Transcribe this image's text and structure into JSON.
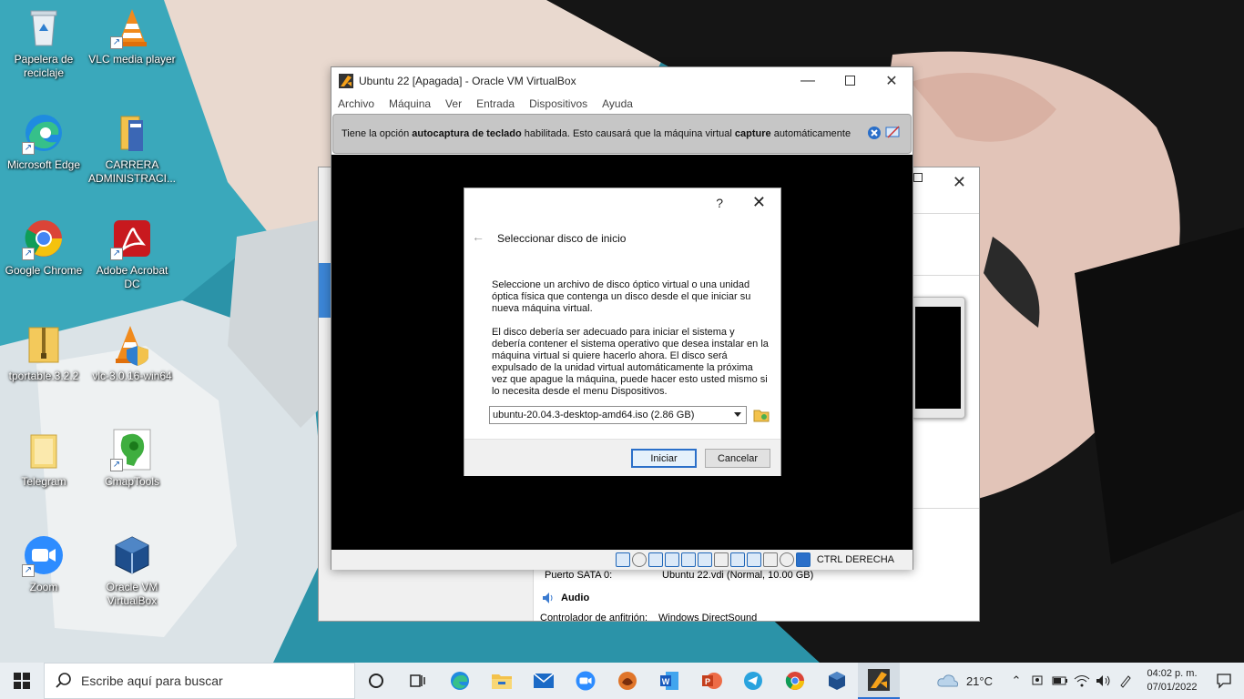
{
  "desktop": {
    "icons": [
      {
        "label": "Papelera de reciclaje",
        "icon": "recycle-bin-icon"
      },
      {
        "label": "VLC media player",
        "icon": "vlc-icon"
      },
      {
        "label": "Microsoft Edge",
        "icon": "edge-icon"
      },
      {
        "label": "CARRERA ADMINISTRACI...",
        "icon": "folder-archive-icon"
      },
      {
        "label": "Google Chrome",
        "icon": "chrome-icon"
      },
      {
        "label": "Adobe Acrobat DC",
        "icon": "acrobat-icon"
      },
      {
        "label": "tportable.3.2.2",
        "icon": "zip-folder-icon"
      },
      {
        "label": "vlc-3.0.16-win64",
        "icon": "vlc-installer-icon"
      },
      {
        "label": "Telegram",
        "icon": "folder-icon"
      },
      {
        "label": "CmapTools",
        "icon": "cmaptools-icon"
      },
      {
        "label": "Zoom",
        "icon": "zoom-icon"
      },
      {
        "label": "Oracle VM VirtualBox",
        "icon": "virtualbox-icon"
      }
    ]
  },
  "back_window": {
    "storage_label": "Puerto SATA 0:",
    "storage_value": "Ubuntu 22.vdi (Normal, 10.00 GB)",
    "audio_heading": "Audio",
    "audio_label": "Controlador de anfitrión:",
    "audio_value": "Windows DirectSound"
  },
  "vm_window": {
    "title": "Ubuntu 22 [Apagada] - Oracle VM VirtualBox",
    "menu": [
      "Archivo",
      "Máquina",
      "Ver",
      "Entrada",
      "Dispositivos",
      "Ayuda"
    ],
    "notification": {
      "part1": "Tiene la opción ",
      "bold1": "autocaptura de teclado",
      "part2": " habilitada. Esto causará que la máquina virtual ",
      "bold2": "capture",
      "part3": " automáticamente"
    },
    "host_key": "CTRL DERECHA"
  },
  "dialog": {
    "help": "?",
    "title": "Seleccionar disco de inicio",
    "paragraph1": "Seleccione un archivo de disco óptico virtual o una unidad óptica física que contenga un disco desde el que iniciar su nueva máquina virtual.",
    "paragraph2": "El disco debería ser adecuado para iniciar el sistema y debería contener el sistema operativo que desea instalar en la máquina virtual si quiere hacerlo ahora. El disco será expulsado de la unidad virtual automáticamente la próxima vez que apague la máquina, puede hacer esto usted mismo si lo necesita desde el menu Dispositivos.",
    "selected_iso": "ubuntu-20.04.3-desktop-amd64.iso (2.86 GB)",
    "start_button": "Iniciar",
    "cancel_button": "Cancelar"
  },
  "taskbar": {
    "search_placeholder": "Escribe aquí para buscar",
    "temperature": "21°C",
    "time": "04:02 p. m.",
    "date": "07/01/2022"
  },
  "colors": {
    "accent": "#2a6fc9",
    "notify_bar": "#c6c6c6",
    "taskbar": "#e9eef2"
  }
}
